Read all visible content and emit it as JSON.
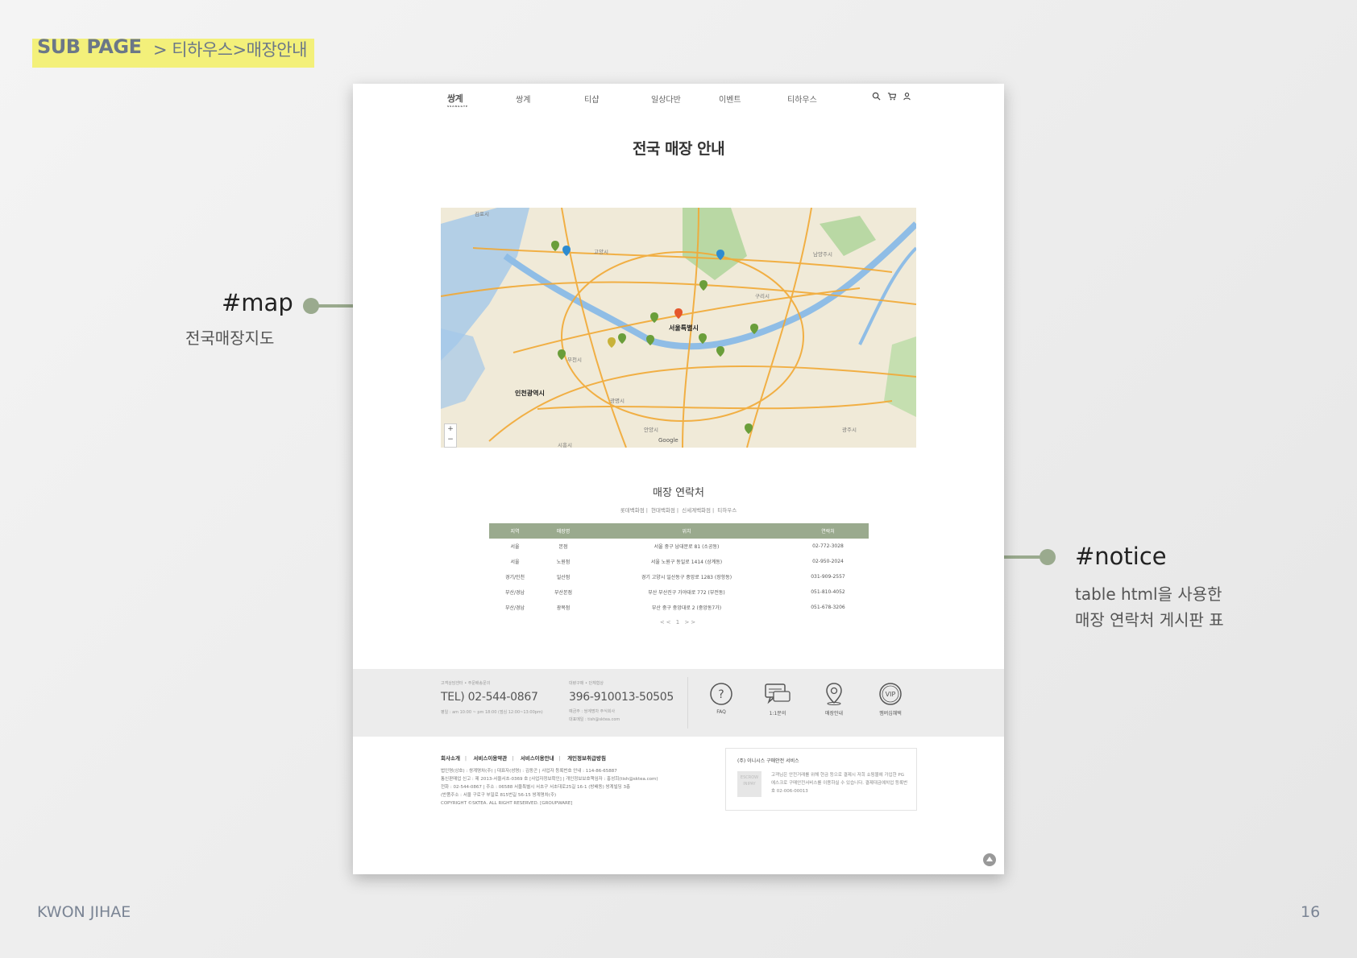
{
  "slide": {
    "sub_title": "SUB PAGE",
    "breadcrumb": "> 티하우스>매장안내",
    "author": "KWON JIHAE",
    "page_number": "16",
    "accent_color": "#9aaa8e",
    "highlight_color": "#f3f07a"
  },
  "annotations": {
    "map": {
      "title": "#map",
      "desc": "전국매장지도"
    },
    "notice": {
      "title": "#notice",
      "desc_line1": "table html을 사용한",
      "desc_line2": "매장 연락처 게시판 표"
    }
  },
  "site": {
    "logo": "쌍계",
    "logo_sub": "SSANGGYE",
    "nav": [
      "쌍계",
      "티샵",
      "일상다반",
      "이벤트",
      "티하우스"
    ],
    "icons": [
      "search-icon",
      "cart-icon",
      "user-icon"
    ],
    "page_title": "전국 매장 안내",
    "map": {
      "labels": [
        "김포시",
        "고양시",
        "남양주시",
        "구리시",
        "서울특별시",
        "부천시",
        "인천광역시",
        "광명시",
        "안양시",
        "시흥시",
        "광주시"
      ],
      "zoom_in": "+",
      "zoom_out": "−",
      "attribution": "Google"
    },
    "contacts": {
      "title": "매장 연락처",
      "tabs": [
        "롯데백화점",
        "현대백화점",
        "신세계백화점",
        "티하우스"
      ],
      "columns": [
        "지역",
        "매장명",
        "위치",
        "연락처"
      ],
      "rows": [
        [
          "서울",
          "본점",
          "서울 중구 남대문로 81 (소공동)",
          "02-772-3028"
        ],
        [
          "서울",
          "노원점",
          "서울 노원구 동일로 1414 (상계동)",
          "02-950-2024"
        ],
        [
          "경기/인천",
          "일산점",
          "경기 고양시 일산동구 중앙로 1283 (장항동)",
          "031-909-2557"
        ],
        [
          "부산/경남",
          "부산본점",
          "부산 부산진구 가야대로 772 (부전동)",
          "051-810-4052"
        ],
        [
          "부산/경남",
          "광복점",
          "부산 중구 중앙대로 2 (중앙동7가)",
          "051-678-3206"
        ]
      ],
      "pager": "<< 1 >>"
    },
    "footer": {
      "cs_label": "고객상담센터 • 주문배송문의",
      "tel": "TEL) 02-544-0867",
      "hours": "평일 : am 10:00 ~ pm 18:00 (점심 12:00~13:00pm)",
      "bank_label": "대량구매 • 단체협상",
      "account": "396-910013-50505",
      "holder": "예금주 : 쌍계명차 주식회사",
      "email": "대표메일 : tish@sktea.com",
      "quick": [
        "FAQ",
        "1:1문의",
        "매장안내",
        "멤버십혜택"
      ],
      "links": [
        "회사소개",
        "서비스이용약관",
        "서비스이용안내",
        "개인정보취급방침"
      ],
      "info": [
        "법인명(상호) : 쌍계명차(주) | 대표자(성명) : 김동곤 | 사업자 등록번호 안내 : 114-86-65887",
        "통신판매업 신고 : 제 2013-서울서초-0369 호 [사업자정보확인] | 개인정보보호책임자 : 홍성희(tish@sktea.com)",
        "전화 : 02-544-0867 | 주소 : 06588 서울특별시 서초구 서초대로25길 16-1 (방배동) 쌍계빌딩 3층",
        "(반품주소 : 서울 구로구 부일로 815번길 56-15 쌍계명차(주)",
        "COPYRIGHT ©SKTEA. ALL RIGHT RESERVED. [GROUPWARE]"
      ],
      "escrow_title": "(주) 이니시스 구매안전 서비스",
      "escrow_badge": "ESCROW INIPAY",
      "escrow_text": "고객님은 안전거래를 위해 현금 등으로 결제시 저희 쇼핑몰에 가입한 PG에스크로 구매안전서비스를 이용하실 수 있습니다. 결제대금예치업 등록번호 02-006-00013"
    }
  }
}
